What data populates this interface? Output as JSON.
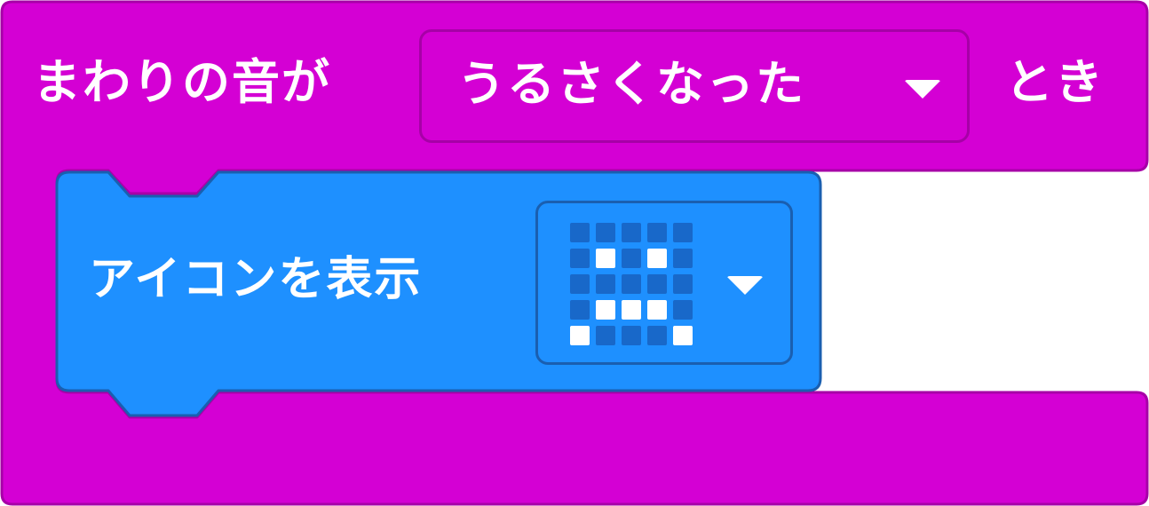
{
  "event_block": {
    "prefix_label": "まわりの音が",
    "dropdown_value": "うるさくなった",
    "suffix_label": "とき",
    "color": "#d400d4",
    "border_color": "#a700a7"
  },
  "show_icon_block": {
    "label": "アイコンを表示",
    "color": "#1e90ff",
    "border_color": "#1a5fb0",
    "icon_leds": [
      [
        0,
        0,
        0,
        0,
        0
      ],
      [
        0,
        1,
        0,
        1,
        0
      ],
      [
        0,
        0,
        0,
        0,
        0
      ],
      [
        0,
        1,
        1,
        1,
        0
      ],
      [
        1,
        0,
        0,
        0,
        1
      ]
    ],
    "led_on_color": "#ffffff",
    "led_off_color": "#1868c9"
  },
  "icons": {
    "dropdown_caret": "caret-down-icon"
  }
}
